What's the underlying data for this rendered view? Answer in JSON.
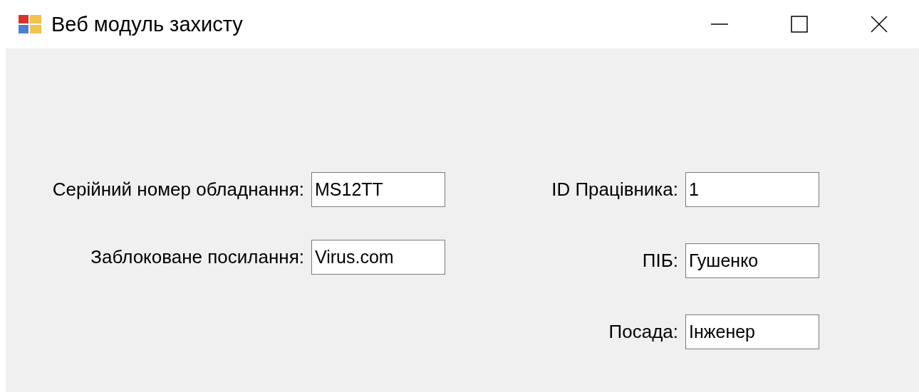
{
  "window": {
    "title": "Веб модуль захисту"
  },
  "left_fields": [
    {
      "label": "Серійний номер обладнання:",
      "value": "MS12TT"
    },
    {
      "label": "Заблоковане посилання:",
      "value": "Virus.com"
    }
  ],
  "right_fields": [
    {
      "label": "ID Працівника:",
      "value": "1"
    },
    {
      "label": "ПІБ:",
      "value": "Гушенко"
    },
    {
      "label": "Посада:",
      "value": "Інженер"
    }
  ]
}
